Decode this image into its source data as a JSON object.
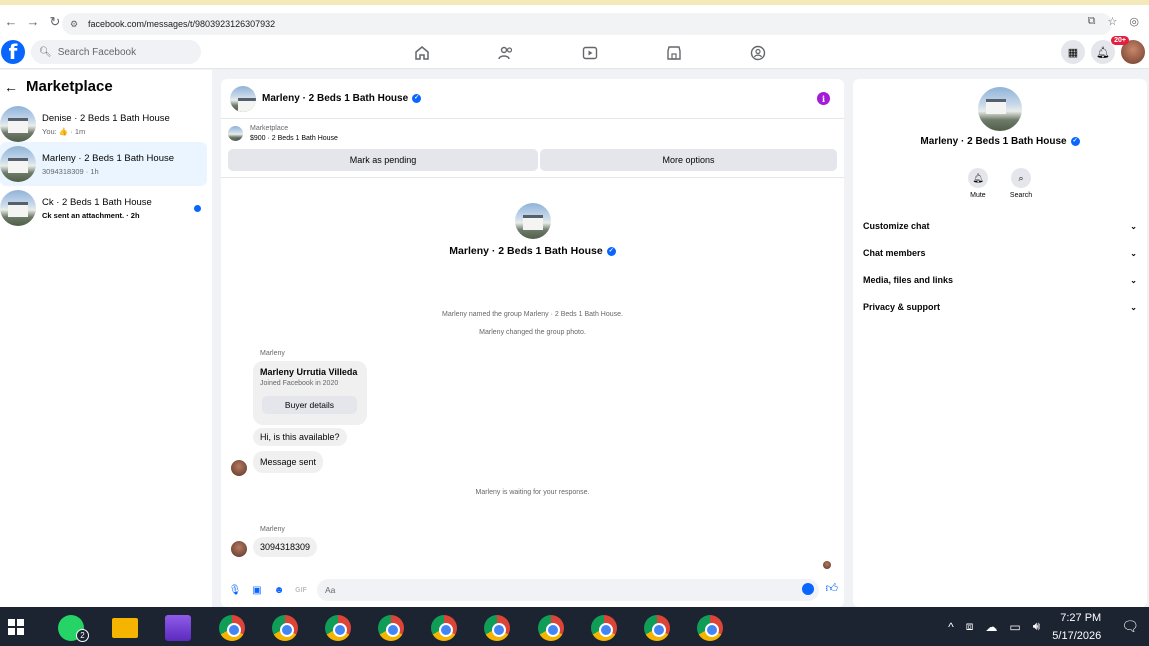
{
  "browser": {
    "url": "facebook.com/messages/t/9803923126307932"
  },
  "header": {
    "logo": "f",
    "search_placeholder": "Search Facebook",
    "notif_badge": "20+"
  },
  "left": {
    "title": "Marketplace",
    "conversations": [
      {
        "name": "Denise · 2 Beds 1 Bath House",
        "sub": "You: 👍 · 1m",
        "active": false,
        "unread": false
      },
      {
        "name": "Marleny · 2 Beds 1 Bath House",
        "sub": "3094318309 · 1h",
        "active": true,
        "unread": false
      },
      {
        "name": "Ck · 2 Beds 1 Bath House",
        "sub": "Ck sent an attachment. · 2h",
        "active": false,
        "unread": true
      }
    ]
  },
  "chat": {
    "title": "Marleny · 2 Beds 1 Bath House",
    "marketplace_label": "Marketplace",
    "listing": "$900 · 2 Beds 1 Bath House",
    "mark_pending": "Mark as pending",
    "more_options": "More options",
    "hero_title": "Marleny · 2 Beds 1 Bath House",
    "sys_named": "Marleny named the group Marleny · 2 Beds 1 Bath House.",
    "sys_photo": "Marleny changed the group photo.",
    "sender1": "Marleny",
    "card_name": "Marleny Urrutia Villeda",
    "card_sub": "Joined Facebook in 2020",
    "card_button": "Buyer details",
    "msg1": "Hi, is this available?",
    "msg2": "Message sent",
    "sys_waiting": "Marleny is waiting for your response.",
    "sender2": "Marleny",
    "msg3": "3094318309",
    "composer_placeholder": "Aa"
  },
  "right": {
    "title": "Marleny · 2 Beds 1 Bath House",
    "mute": "Mute",
    "search": "Search",
    "items": [
      "Customize chat",
      "Chat members",
      "Media, files and links",
      "Privacy & support"
    ]
  },
  "taskbar": {
    "whatsapp_count": "2",
    "time": "7:27 PM",
    "date": "5/17/2026"
  }
}
